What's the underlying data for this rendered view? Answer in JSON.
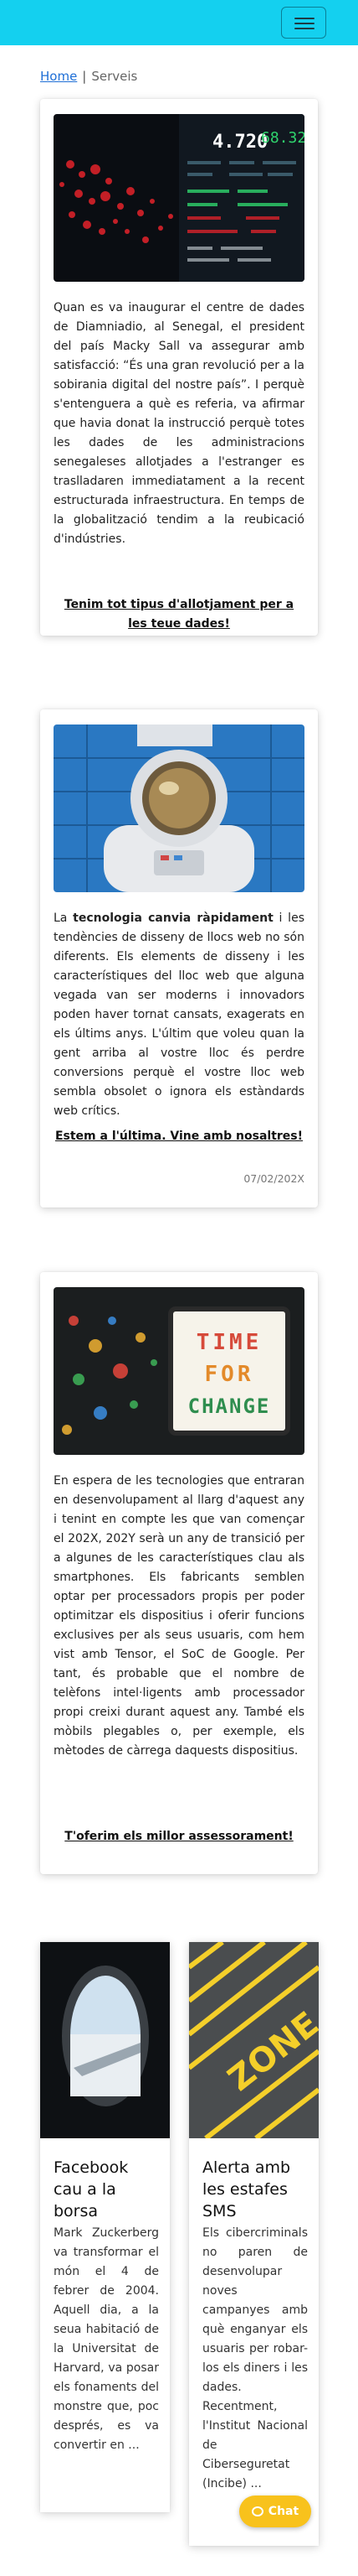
{
  "nav": {
    "menu_icon": "hamburger-icon",
    "topbar_color": "#14d0ef"
  },
  "breadcrumb": {
    "home": "Home",
    "separator": "|",
    "current": "Serveis"
  },
  "cards": [
    {
      "image": "stock-market-screen",
      "image_readout_1": "4.720",
      "image_readout_2": "68.324",
      "text": "Quan es va inaugurar el centre de dades de Diamniadio, al Senegal, el president del país Macky Sall va assegurar amb satisfacció: “És una gran revolució per a la sobirania digital del nostre país”. I perquè s'entenguera a què es referia, va afirmar que havia donat la instrucció perquè totes les dades de les administracions senegaleses allotjades a l'estranger es traslladaren immediatament a la recent estructurada infraestructura. En temps de la globalització tendim a la reubicació d'indústries.",
      "cta": "Tenim tot tipus d'allotjament per a les teue dades!"
    },
    {
      "image": "astronaut-mural",
      "text_pre": "La ",
      "text_bold": "tecnologia canvia ràpidament",
      "text_post": " i les tendències de disseny de llocs web no són diferents. Els elements de disseny i les característiques del lloc web que alguna vegada van ser moderns i innovadors poden haver tornat cansats, exagerats en els últims anys. L'últim que voleu quan la gent arriba al vostre lloc és perdre conversions perquè el vostre lloc web sembla obsolet o ignora els estàndards web crítics.",
      "cta": "Estem a l'última. Vine amb nosaltres!",
      "date": "07/02/202X"
    },
    {
      "image": "lightbox-time-for-change",
      "image_words": [
        "TIME",
        "FOR",
        "CHANGE"
      ],
      "text": "En espera de les tecnologies que entraran en desenvolupament al llarg d'aquest any i tenint en compte les que van començar el 202X, 202Y serà un any de transició per a algunes de les característiques clau als smartphones. Els fabricants semblen optar per processadors propis per poder optimitzar els dispositius i oferir funcions exclusives per als seus usuaris, com hem vist amb Tensor, el SoC de Google. Per tant, és probable que el nombre de telèfons intel·ligents amb processador propi creixi durant aquest any. També els mòbils plegables o, per exemple, els mètodes de càrrega daquests dispositius.",
      "cta": "T'oferim els millor assessorament!"
    }
  ],
  "news": [
    {
      "image": "airplane-window",
      "title": "Facebook cau a la borsa",
      "excerpt": "Mark Zuckerberg va transformar el món el 4 de febrer de 2004. Aquell dia, a la seua habitació de la Universitat de Harvard, va posar els fonaments del monstre que, poc després, es va convertir en ..."
    },
    {
      "image": "zone-road-marking",
      "image_word": "ZONE",
      "title": "Alerta amb les estafes SMS",
      "excerpt": "Els cibercriminals no paren de desenvolupar noves campanyes amb què enganyar els usuaris per robar-los els diners i les dades. Recentment, l'Institut Nacional de Ciberseguretat (Incibe) ..."
    }
  ],
  "chat": {
    "label": "Chat",
    "color": "#f8c21c"
  }
}
